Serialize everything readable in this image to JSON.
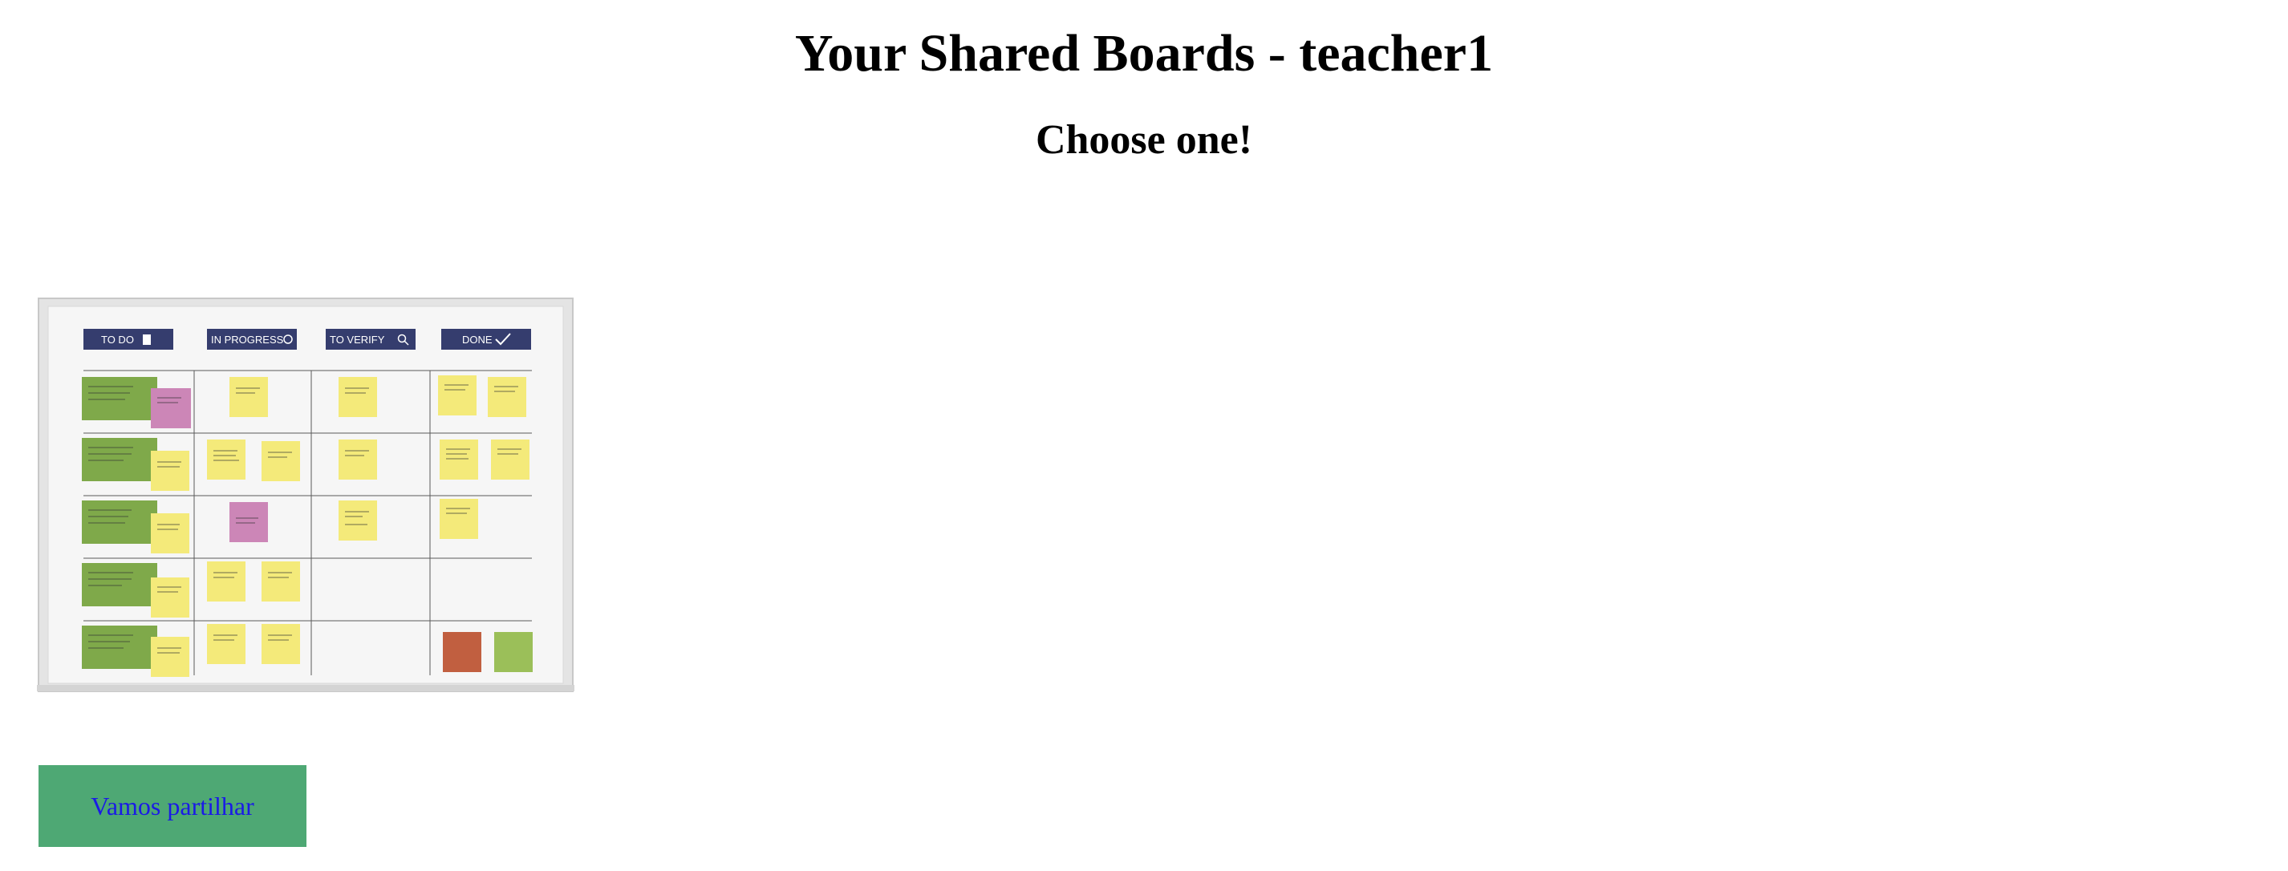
{
  "header": {
    "title": "Your Shared Boards - teacher1",
    "subtitle": "Choose one!"
  },
  "boards": [
    {
      "button_label": "Vamos partilhar",
      "button_color": "#4ea874",
      "link_color": "#1a1ae6",
      "thumbnail": {
        "columns": [
          "TO DO",
          "IN PROGRESS",
          "TO VERIFY",
          "DONE"
        ],
        "column_icons": [
          "clipboard-icon",
          "refresh-icon",
          "magnifier-icon",
          "checkmark-icon"
        ],
        "header_color": "#353d6e",
        "note_colors": {
          "yellow": "#f4ea7a",
          "green": "#7fa94a",
          "pink": "#cc86b7",
          "red": "#c15f40",
          "lime": "#9bbf59"
        }
      }
    }
  ]
}
